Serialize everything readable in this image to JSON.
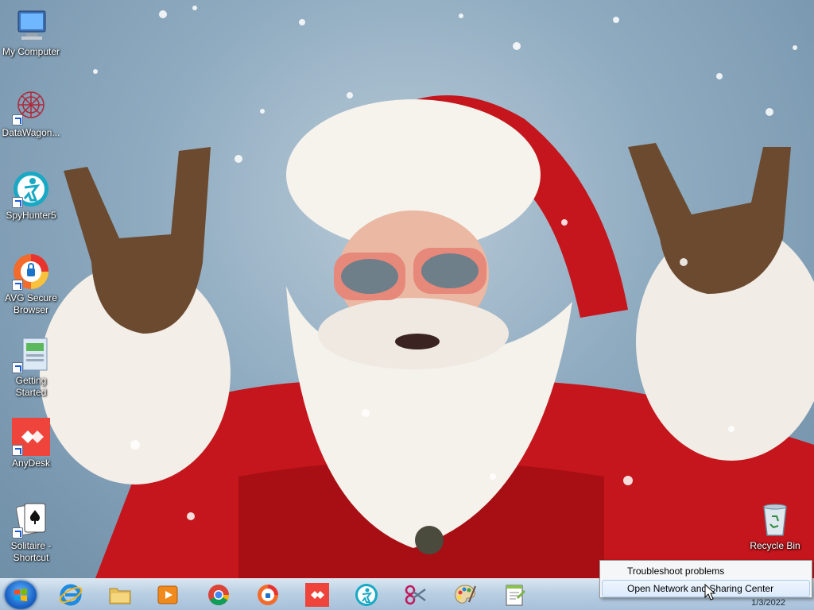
{
  "desktop": {
    "icons": [
      {
        "label": "My Computer",
        "icon": "computer-icon"
      },
      {
        "label": "DataWagon...",
        "icon": "datawagon-icon"
      },
      {
        "label": "SpyHunter5",
        "icon": "spyhunter-icon"
      },
      {
        "label": "AVG Secure Browser",
        "icon": "avg-browser-icon"
      },
      {
        "label": "Getting Started",
        "icon": "getting-started-icon"
      },
      {
        "label": "AnyDesk",
        "icon": "anydesk-icon"
      },
      {
        "label": "Solitaire - Shortcut",
        "icon": "solitaire-icon"
      },
      {
        "label": "Recycle Bin",
        "icon": "recycle-bin-icon"
      }
    ]
  },
  "taskbar": {
    "pinned": [
      {
        "name": "internet-explorer",
        "icon": "internet-explorer-icon"
      },
      {
        "name": "file-explorer",
        "icon": "folder-icon"
      },
      {
        "name": "media-player",
        "icon": "media-player-icon"
      },
      {
        "name": "chrome",
        "icon": "chrome-icon"
      },
      {
        "name": "avg-browser",
        "icon": "avg-browser-icon"
      },
      {
        "name": "anydesk",
        "icon": "anydesk-icon"
      },
      {
        "name": "spyhunter",
        "icon": "spyhunter-icon"
      },
      {
        "name": "snipping-tool",
        "icon": "scissors-icon"
      },
      {
        "name": "paint",
        "icon": "paint-palette-icon"
      },
      {
        "name": "notepad-plus",
        "icon": "notepad-plus-icon"
      }
    ],
    "clock_date": "1/3/2022"
  },
  "context_menu": {
    "items": [
      {
        "label": "Troubleshoot problems"
      },
      {
        "label": "Open Network and Sharing Center"
      }
    ]
  },
  "colors": {
    "santa_red": "#c4161c",
    "taskbar": "#b9cfe3",
    "menu_hover": "#dcebfc"
  }
}
